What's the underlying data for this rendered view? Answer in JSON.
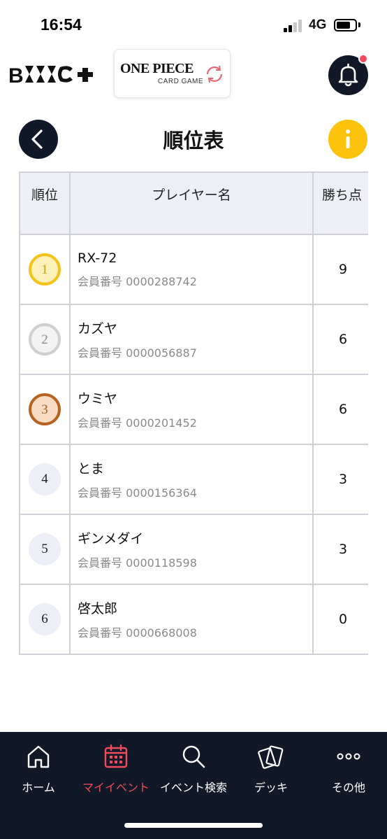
{
  "status_bar": {
    "time": "16:54",
    "network": "4G",
    "signal_bars": 2,
    "signal_bars_total": 4
  },
  "header": {
    "brand_logo": "B-TCG+",
    "game_logo_title": "ONE PIECE",
    "game_logo_subtitle": "CARD GAME",
    "bell_icon": "bell-icon",
    "has_notification": true
  },
  "page": {
    "title": "順位表",
    "back_icon": "chevron-left-icon",
    "info_icon": "info-icon"
  },
  "table": {
    "headers": {
      "rank": "順位",
      "player": "プレイヤー名",
      "score": "勝ち点"
    },
    "rows": [
      {
        "rank": "1",
        "medal": "gold",
        "name": "RX-72",
        "member": "会員番号 0000288742",
        "score": "9"
      },
      {
        "rank": "2",
        "medal": "silver",
        "name": "カズヤ",
        "member": "会員番号 0000056887",
        "score": "6"
      },
      {
        "rank": "3",
        "medal": "bronze",
        "name": "ウミヤ",
        "member": "会員番号 0000201452",
        "score": "6"
      },
      {
        "rank": "4",
        "medal": "plain",
        "name": "とま",
        "member": "会員番号 0000156364",
        "score": "3"
      },
      {
        "rank": "5",
        "medal": "plain",
        "name": "ギンメダイ",
        "member": "会員番号 0000118598",
        "score": "3"
      },
      {
        "rank": "6",
        "medal": "plain",
        "name": "啓太郎",
        "member": "会員番号 0000668008",
        "score": "0"
      }
    ]
  },
  "bottom_nav": {
    "items": [
      {
        "label": "ホーム",
        "icon": "home-icon",
        "active": false
      },
      {
        "label": "マイイベント",
        "icon": "calendar-icon",
        "active": true
      },
      {
        "label": "イベント検索",
        "icon": "search-icon",
        "active": false
      },
      {
        "label": "デッキ",
        "icon": "cards-icon",
        "active": false
      },
      {
        "label": "その他",
        "icon": "more-icon",
        "active": false
      }
    ]
  },
  "colors": {
    "dark": "#111827",
    "accent_red": "#ef4b5c",
    "info_yellow": "#fbc30b",
    "gold": "#f5c21a",
    "silver": "#cfcfd4",
    "bronze": "#b8621f",
    "header_bg": "#eeeef7"
  }
}
